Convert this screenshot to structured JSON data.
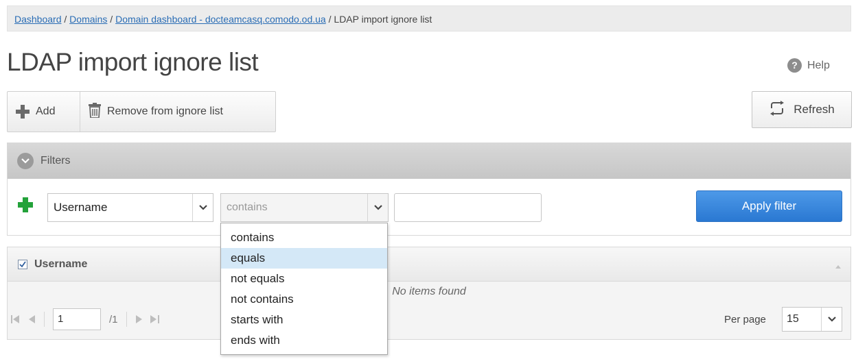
{
  "breadcrumb": {
    "items": [
      "Dashboard",
      "Domains",
      "Domain dashboard - docteamcasq.comodo.od.ua"
    ],
    "current": "LDAP import ignore list",
    "separator": " / "
  },
  "page": {
    "title": "LDAP import ignore list",
    "help_label": "Help"
  },
  "toolbar": {
    "add_label": "Add",
    "remove_label": "Remove from ignore list",
    "refresh_label": "Refresh"
  },
  "filters": {
    "header_label": "Filters",
    "field_value": "Username",
    "operator_placeholder": "contains",
    "operator_options": [
      "contains",
      "equals",
      "not equals",
      "not contains",
      "starts with",
      "ends with"
    ],
    "highlighted_option": "equals",
    "text_value": "",
    "apply_label": "Apply filter"
  },
  "grid": {
    "column_header": "Username",
    "select_all_checked": true,
    "empty_message": "No items found"
  },
  "pager": {
    "current_page": "1",
    "total_pages": "/1",
    "per_page_label": "Per page",
    "per_page_value": "15"
  },
  "colors": {
    "accent_blue": "#2a78d2",
    "add_green": "#23a23a",
    "link_blue": "#2a6db5",
    "highlight": "#d4e8f7"
  }
}
